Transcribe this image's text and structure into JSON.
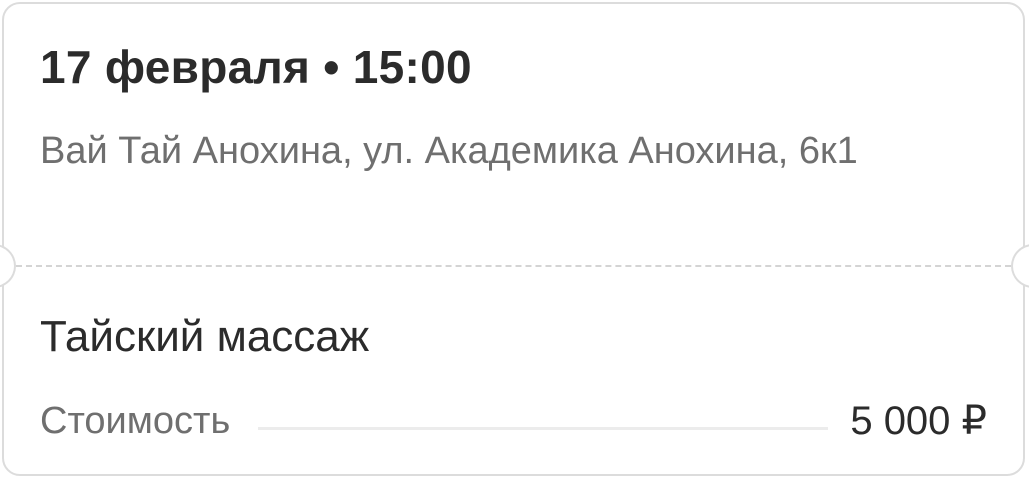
{
  "booking": {
    "date_time": "17 февраля • 15:00",
    "address": "Вай Тай Анохина, ул. Академика Анохина, 6к1",
    "service": "Тайский массаж",
    "cost_label": "Стоимость",
    "cost_value": "5 000 ₽"
  },
  "colors": {
    "primary_text": "#2b2b2b",
    "secondary_text": "#6f6f6f",
    "border": "#dcdcdc",
    "divider": "#d4d4d4"
  }
}
